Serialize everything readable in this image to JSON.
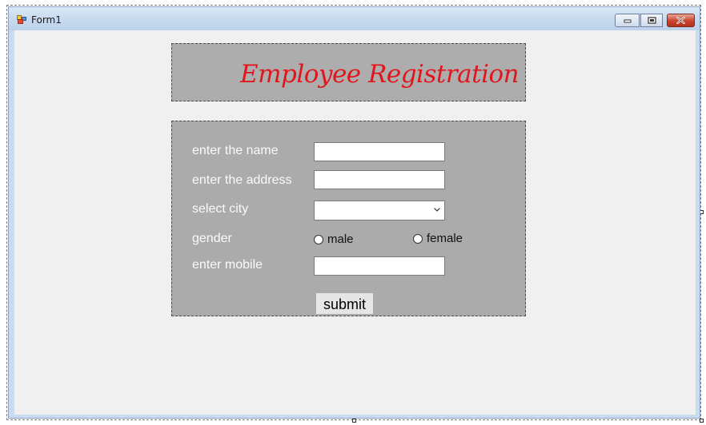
{
  "window": {
    "title": "Form1",
    "icon": "form-app-icon",
    "controls": [
      "minimize-icon",
      "maximize-icon",
      "close-icon"
    ]
  },
  "header": {
    "title": "Employee Registration",
    "title_color": "#e0161c"
  },
  "form": {
    "name_label": "enter the name",
    "name_value": "",
    "address_label": "enter the address",
    "address_value": "",
    "city_label": "select city",
    "city_selected": "",
    "gender_label": "gender",
    "gender_options": [
      "male",
      "female"
    ],
    "mobile_label": "enter mobile",
    "mobile_value": "",
    "submit_label": "submit"
  },
  "colors": {
    "panel_bg": "#ababab",
    "client_bg": "#f0f0f0",
    "label_text": "#fafafa"
  }
}
